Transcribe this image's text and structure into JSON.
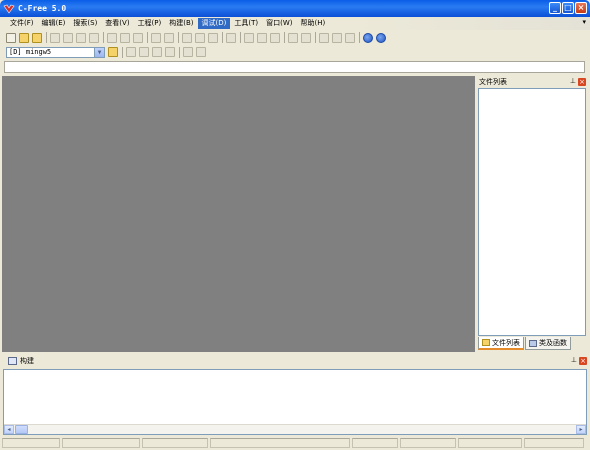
{
  "window": {
    "title": "C-Free 5.0",
    "minimize_glyph": "_",
    "maximize_glyph": "□",
    "close_glyph": "×"
  },
  "menu": {
    "items": [
      {
        "label": "文件(F)"
      },
      {
        "label": "编辑(E)"
      },
      {
        "label": "搜索(S)"
      },
      {
        "label": "查看(V)"
      },
      {
        "label": "工程(P)"
      },
      {
        "label": "构建(B)"
      },
      {
        "label": "调试(D)",
        "active": true
      },
      {
        "label": "工具(T)"
      },
      {
        "label": "窗口(W)"
      },
      {
        "label": "帮助(H)"
      }
    ],
    "overflow": "▾"
  },
  "toolbar2": {
    "compiler_selected": "[D] mingw5"
  },
  "file_panel": {
    "title": "文件列表",
    "pin": "⊥",
    "close": "×",
    "tabs": [
      {
        "label": "文件列表",
        "active": true
      },
      {
        "label": "类及函数",
        "active": false
      }
    ]
  },
  "build_panel": {
    "title": "构建",
    "pin": "⊥",
    "close": "×",
    "scroll_left": "◂",
    "scroll_right": "▸"
  },
  "colors": {
    "editor_bg": "#808080",
    "menu_active_bg": "#316ac5",
    "title_bar": "#0a5ee6"
  }
}
